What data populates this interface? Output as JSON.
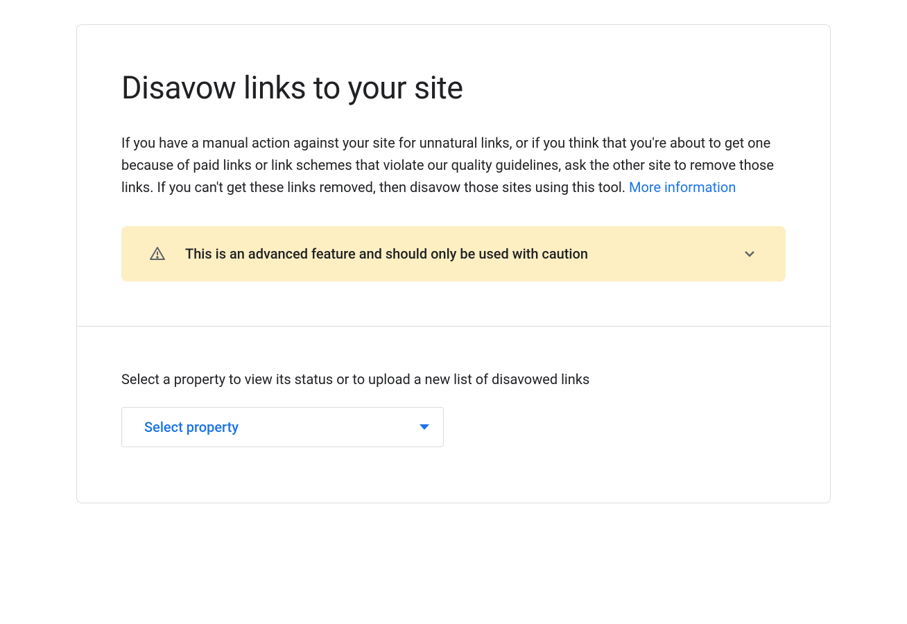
{
  "header": {
    "title": "Disavow links to your site"
  },
  "description": {
    "text": "If you have a manual action against your site for unnatural links, or if you think that you're about to get one because of paid links or link schemes that violate our quality guidelines, ask the other site to remove those links. If you can't get these links removed, then disavow those sites using this tool. ",
    "link_text": "More information"
  },
  "warning": {
    "text": "This is an advanced feature and should only be used with caution"
  },
  "select_section": {
    "label": "Select a property to view its status or to upload a new list of disavowed links",
    "placeholder": "Select property"
  },
  "colors": {
    "link": "#1a73e8",
    "warning_bg": "#feefc3",
    "border": "#dadce0",
    "text": "#202124",
    "icon": "#5f6368"
  }
}
